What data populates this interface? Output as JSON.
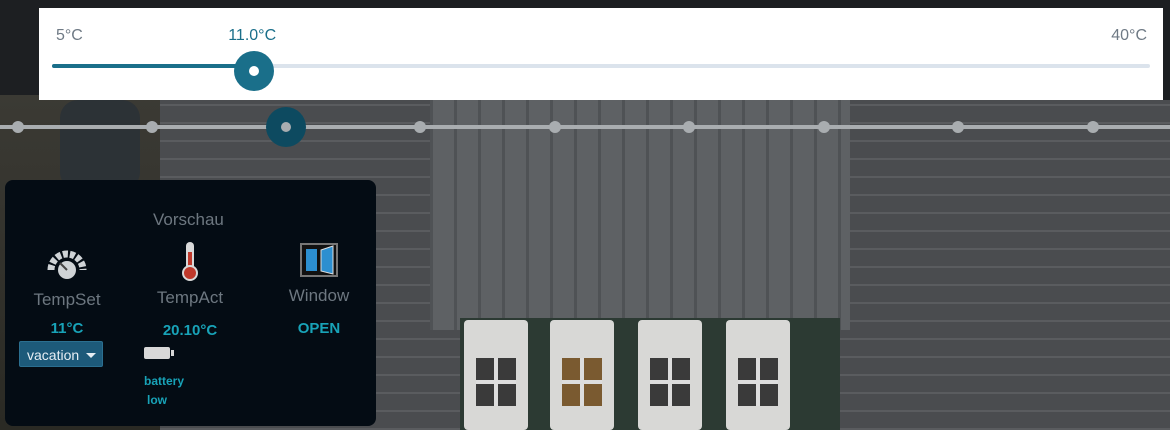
{
  "slider": {
    "min_label": "5°C",
    "max_label": "40°C",
    "value_label": "11.0°C",
    "min": 5,
    "max": 40,
    "value": 11.0,
    "accent_color": "#1a6f8a"
  },
  "panel": {
    "title": "Vorschau",
    "temp_set": {
      "label": "TempSet",
      "value": "11°C",
      "icon": "thermostat-dial-icon"
    },
    "temp_act": {
      "label": "TempAct",
      "value": "20.10°C",
      "icon": "thermometer-icon"
    },
    "window": {
      "label": "Window",
      "value": "OPEN",
      "icon": "window-open-icon"
    },
    "mode": {
      "selected": "vacation"
    },
    "battery": {
      "line1": "battery",
      "line2": "low",
      "icon": "battery-icon"
    },
    "value_color": "#18a3b8"
  }
}
